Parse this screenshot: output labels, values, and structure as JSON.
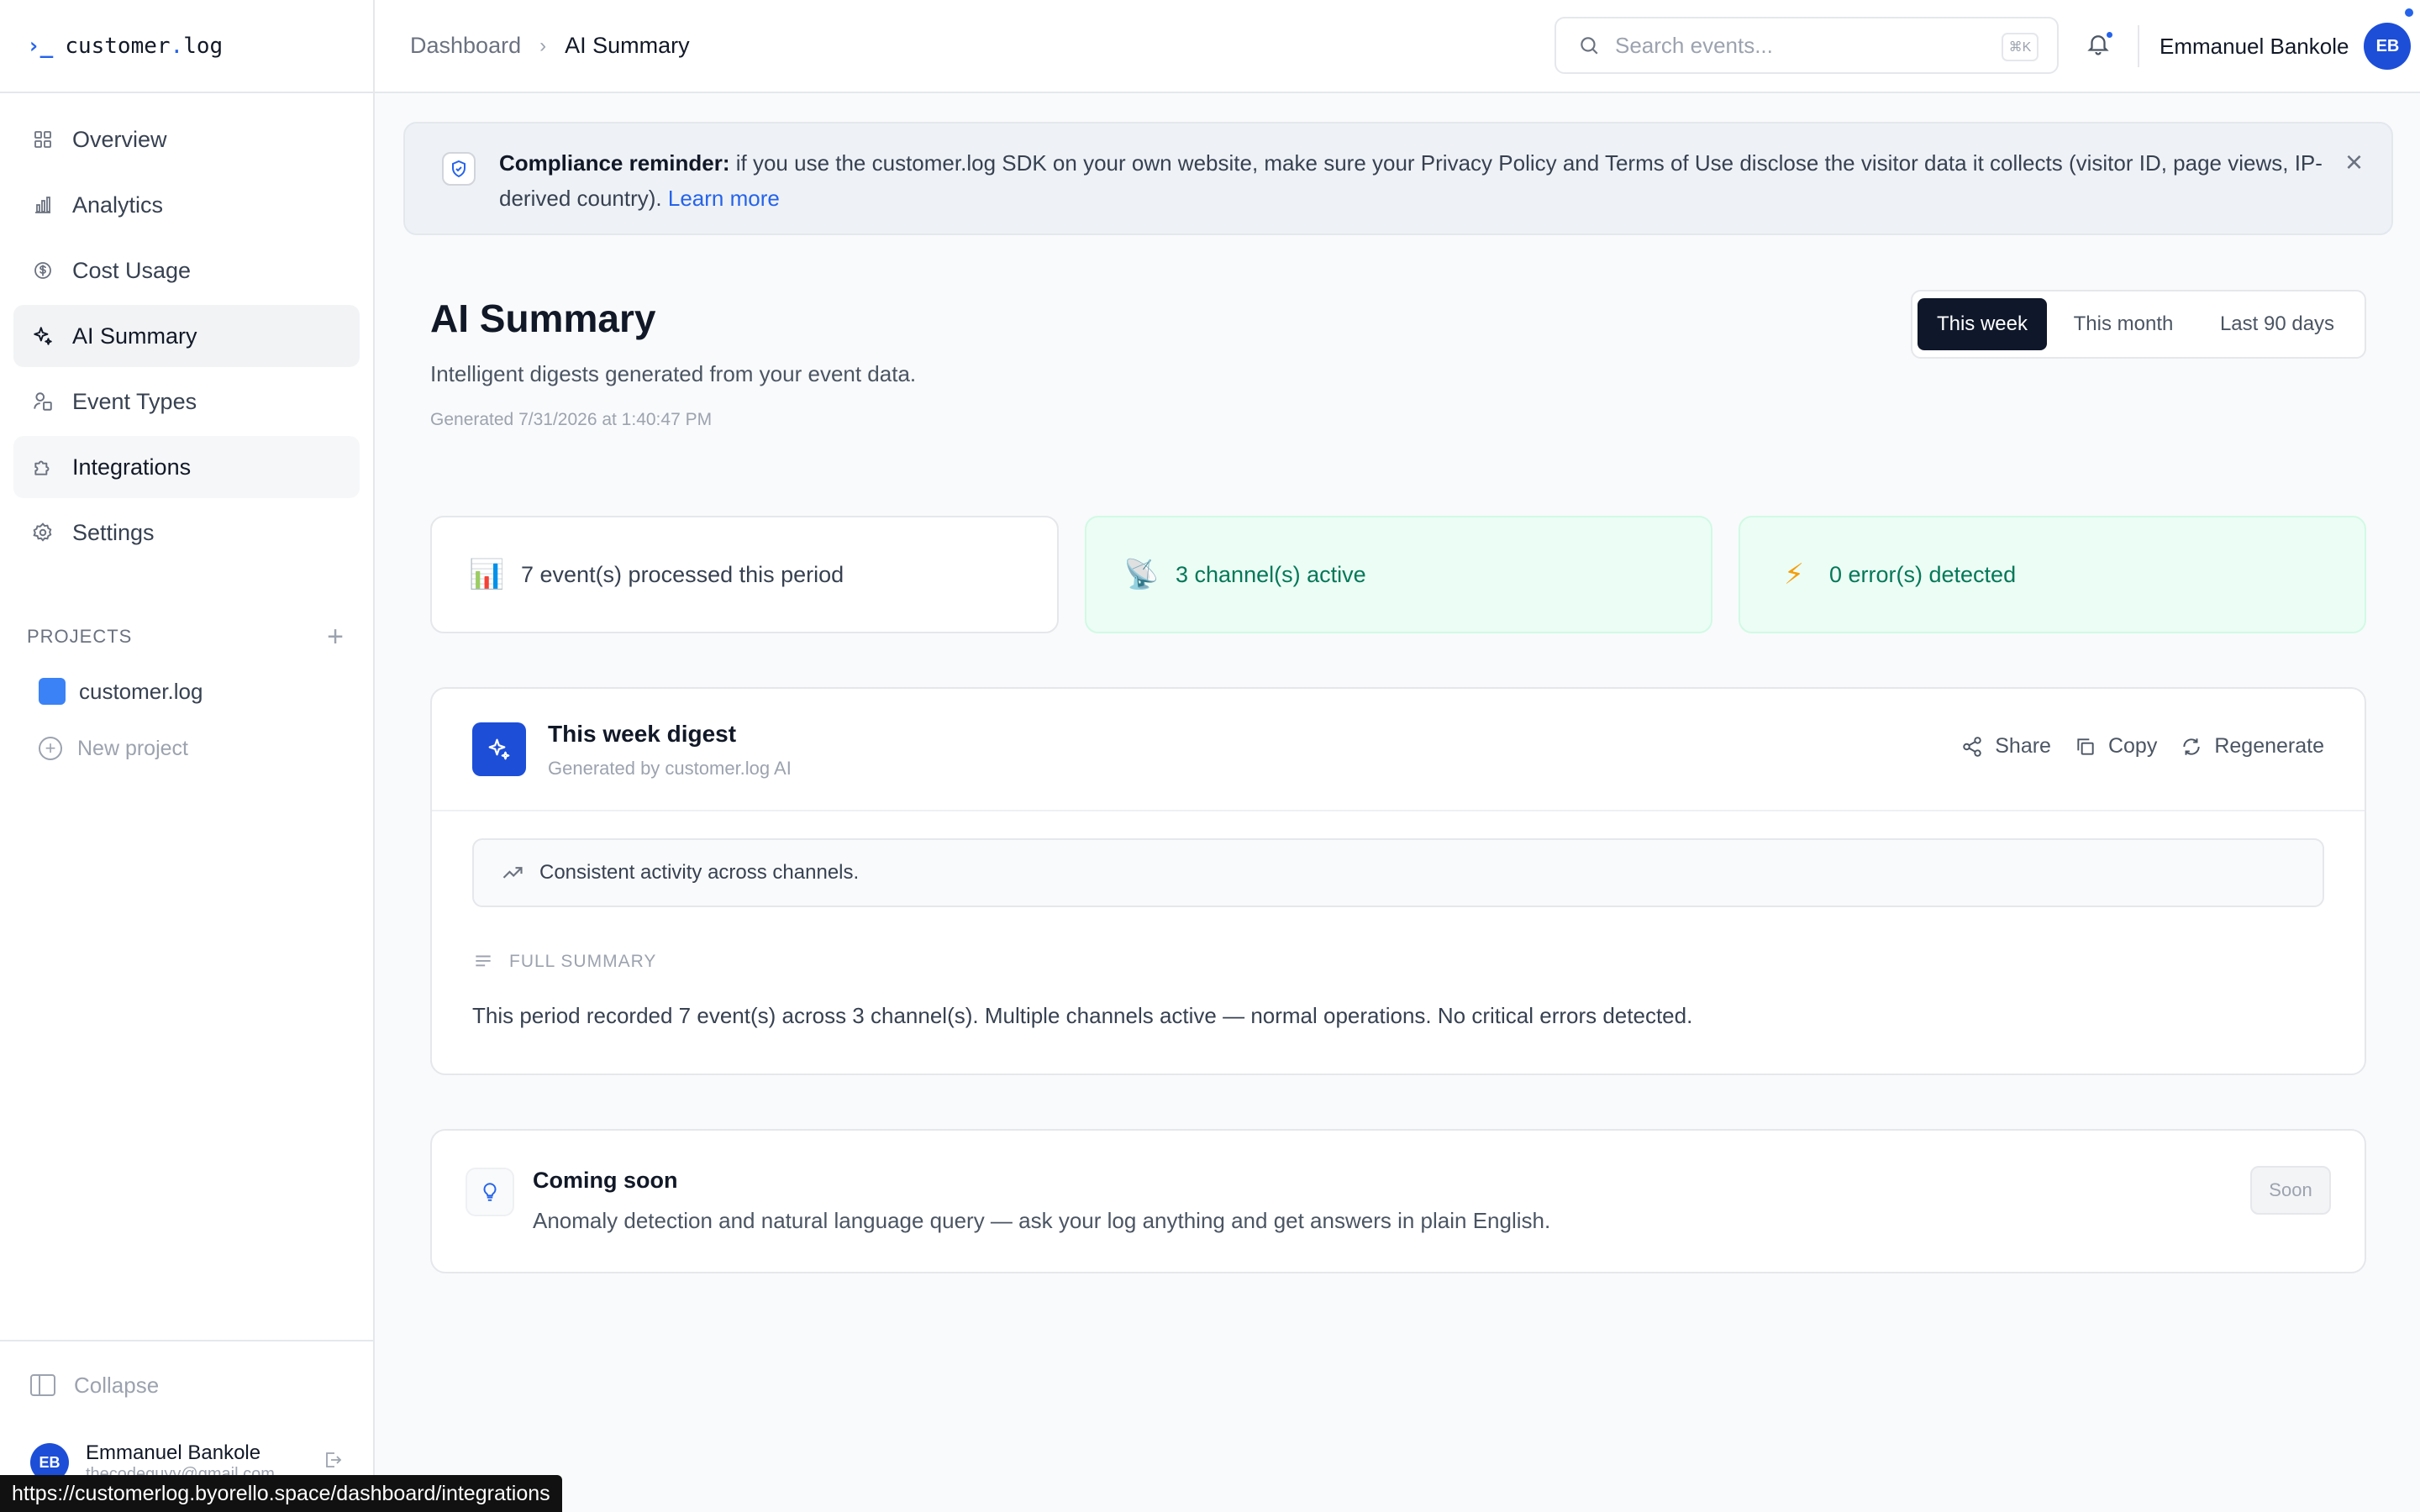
{
  "app": {
    "brand_prefix": "customer",
    "brand_dot": ".",
    "brand_suffix": "log",
    "accent_color": "#2563eb"
  },
  "sidebar": {
    "items": [
      {
        "label": "Overview",
        "icon": "grid-icon"
      },
      {
        "label": "Analytics",
        "icon": "bar-chart-icon"
      },
      {
        "label": "Cost Usage",
        "icon": "dollar-circle-icon"
      },
      {
        "label": "AI Summary",
        "icon": "sparkles-icon",
        "active": true
      },
      {
        "label": "Event Types",
        "icon": "shapes-icon"
      },
      {
        "label": "Integrations",
        "icon": "puzzle-icon",
        "hovered": true
      },
      {
        "label": "Settings",
        "icon": "gear-icon"
      }
    ],
    "projects_heading": "PROJECTS",
    "projects": [
      {
        "name": "customer.log",
        "color": "#3b82f6"
      }
    ],
    "new_project_label": "New project",
    "collapse_label": "Collapse",
    "user": {
      "initials": "EB",
      "name": "Emmanuel Bankole",
      "email": "thecodeguyy@gmail.com"
    }
  },
  "header": {
    "breadcrumb": [
      "Dashboard",
      "AI Summary"
    ],
    "search_placeholder": "Search events...",
    "search_shortcut": "⌘K",
    "user_name": "Emmanuel Bankole",
    "user_initials": "EB"
  },
  "banner": {
    "title": "Compliance reminder:",
    "text": " if you use the customer.log SDK on your own website, make sure your Privacy Policy and Terms of Use disclose the visitor data it collects (visitor ID, page views, IP-derived country). ",
    "link": "Learn more"
  },
  "page": {
    "title": "AI Summary",
    "subtitle": "Intelligent digests generated from your event data.",
    "generated": "Generated 7/31/2026 at 1:40:47 PM",
    "periods": [
      {
        "label": "This week",
        "active": true
      },
      {
        "label": "This month",
        "active": false
      },
      {
        "label": "Last 90 days",
        "active": false
      }
    ]
  },
  "stats": [
    {
      "emoji": "📊",
      "text": "7 event(s) processed this period"
    },
    {
      "emoji": "📡",
      "text": "3 channel(s) active"
    },
    {
      "emoji": "⚡",
      "text": "0 error(s) detected"
    }
  ],
  "digest": {
    "title": "This week digest",
    "subtitle": "Generated by customer.log AI",
    "actions": {
      "share": "Share",
      "copy": "Copy",
      "regenerate": "Regenerate"
    },
    "insight": "Consistent activity across channels.",
    "full_summary_label": "FULL SUMMARY",
    "full_summary": "This period recorded 7 event(s) across 3 channel(s). Multiple channels active — normal operations. No critical errors detected."
  },
  "coming_soon": {
    "title": "Coming soon",
    "description": "Anomaly detection and natural language query — ask your log anything and get answers in plain English.",
    "badge": "Soon"
  },
  "status_url": "https://customerlog.byorello.space/dashboard/integrations"
}
